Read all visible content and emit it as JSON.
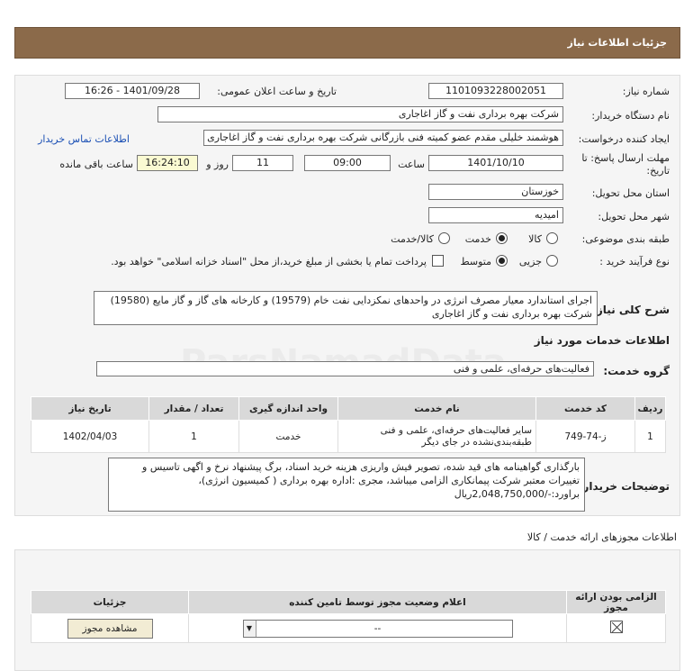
{
  "header": {
    "title": "جزئیات اطلاعات نیاز"
  },
  "form": {
    "need_number_label": "شماره نیاز:",
    "need_number": "1101093228002051",
    "announce_label": "تاریخ و ساعت اعلان عمومی:",
    "announce_value": "1401/09/28 - 16:26",
    "buyer_org_label": "نام دستگاه خریدار:",
    "buyer_org": "شرکت بهره برداری نفت و گاز اغاجاری",
    "creator_label": "ایجاد کننده درخواست:",
    "creator": "هوشمند خلیلی مقدم عضو کمیته فنی بازرگانی شرکت بهره برداری نفت و گاز اغاجاری",
    "contact_link": "اطلاعات تماس خریدار",
    "deadline_label": "مهلت ارسال پاسخ: تا تاریخ:",
    "deadline_date": "1401/10/10",
    "time_label": "ساعت",
    "deadline_time": "09:00",
    "days_value": "11",
    "days_label": "روز و",
    "remaining_time": "16:24:10",
    "remaining_label": "ساعت باقی مانده",
    "province_label": "استان محل تحویل:",
    "province": "خوزستان",
    "city_label": "شهر محل تحویل:",
    "city": "امیدیه",
    "category_label": "طبقه بندی موضوعی:",
    "category_options": [
      "کالا",
      "خدمت",
      "کالا/خدمت"
    ],
    "purchase_type_label": "نوع فرآیند خرید :",
    "purchase_options": [
      "جزیی",
      "متوسط"
    ],
    "payment_note": "پرداخت تمام یا بخشی از مبلغ خرید،از محل \"اسناد خزانه اسلامی\" خواهد بود."
  },
  "summary": {
    "label": "شرح کلی نیاز:",
    "text": "اجرای استاندارد معیار مصرف انرژی در واحدهای نمکزدایی نفت خام (19579) و کارخانه های گاز و گاز مایع (19580) شرکت بهره برداری نفت و گاز اغاجاری"
  },
  "services": {
    "title": "اطلاعات خدمات مورد نیاز",
    "group_label": "گروه خدمت:",
    "group_value": "فعالیت‌های حرفه‌ای، علمی و فنی",
    "columns": [
      "ردیف",
      "کد خدمت",
      "نام خدمت",
      "واحد اندازه گیری",
      "تعداد / مقدار",
      "تاریخ نیاز"
    ],
    "rows": [
      {
        "row": "1",
        "code": "ز-74-749",
        "name": "سایر فعالیت‌های حرفه‌ای، علمی و فنی طبقه‌بندی‌نشده در جای دیگر",
        "unit": "خدمت",
        "qty": "1",
        "date": "1402/04/03"
      }
    ]
  },
  "buyer_notes": {
    "label": "توضیحات خریدار:",
    "text": "بارگذاری گواهینامه های قید شده، تصویر فیش واریزی هزینه خرید اسناد، برگ پیشنهاد نرخ و اگهی تاسیس و تغییرات معتبر شرکت پیمانکاری الزامی میباشد، مجری :اداره بهره برداری ( کمیسیون انرژی)، براورد:-/2,048,750,000ریال"
  },
  "permits": {
    "title": "اطلاعات مجوزهای ارائه خدمت / کالا",
    "columns": [
      "الزامی بودن ارائه مجوز",
      "اعلام وضعیت مجوز توسط تامین کننده",
      "جزئیات"
    ],
    "select_value": "--",
    "view_button": "مشاهده مجوز"
  }
}
